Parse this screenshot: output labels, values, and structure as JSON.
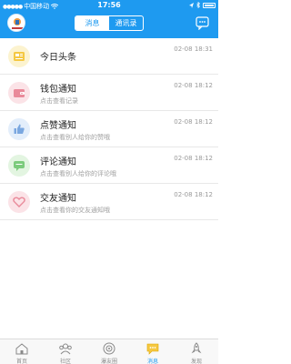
{
  "status_bar": {
    "carrier": "中国移动",
    "time": "17:56"
  },
  "header": {
    "segments": [
      {
        "label": "消息",
        "active": true
      },
      {
        "label": "通讯录",
        "active": false
      }
    ],
    "accent_color": "#1e9af0"
  },
  "messages": [
    {
      "icon": "news-icon",
      "icon_color": "#f5d76e",
      "icon_bg": "#fcf3cf",
      "title": "今日头条",
      "subtitle": "",
      "time": "02-08 18:31"
    },
    {
      "icon": "wallet-icon",
      "icon_color": "#e98a9a",
      "icon_bg": "#fbe3e7",
      "title": "钱包通知",
      "subtitle": "点击查看记录",
      "time": "02-08 18:12"
    },
    {
      "icon": "thumbs-up-icon",
      "icon_color": "#7aa7e0",
      "icon_bg": "#e3eefb",
      "title": "点赞通知",
      "subtitle": "点击查看别人给你的赞哦",
      "time": "02-08 18:12"
    },
    {
      "icon": "comment-icon",
      "icon_color": "#7ccb7c",
      "icon_bg": "#e3f5e1",
      "title": "评论通知",
      "subtitle": "点击查看别人给你的评论哦",
      "time": "02-08 18:12"
    },
    {
      "icon": "heart-icon",
      "icon_color": "#e98a9a",
      "icon_bg": "#fbe3e7",
      "title": "交友通知",
      "subtitle": "点击查看你的交友通知哦",
      "time": "02-08 18:12"
    }
  ],
  "tabbar": {
    "tabs": [
      {
        "label": "首页",
        "icon": "home-icon",
        "active": false
      },
      {
        "label": "社区",
        "icon": "community-icon",
        "active": false
      },
      {
        "label": "瀑友圈",
        "icon": "friends-circle-icon",
        "active": false
      },
      {
        "label": "消息",
        "icon": "message-icon",
        "active": true
      },
      {
        "label": "发现",
        "icon": "rocket-icon",
        "active": false
      }
    ]
  }
}
